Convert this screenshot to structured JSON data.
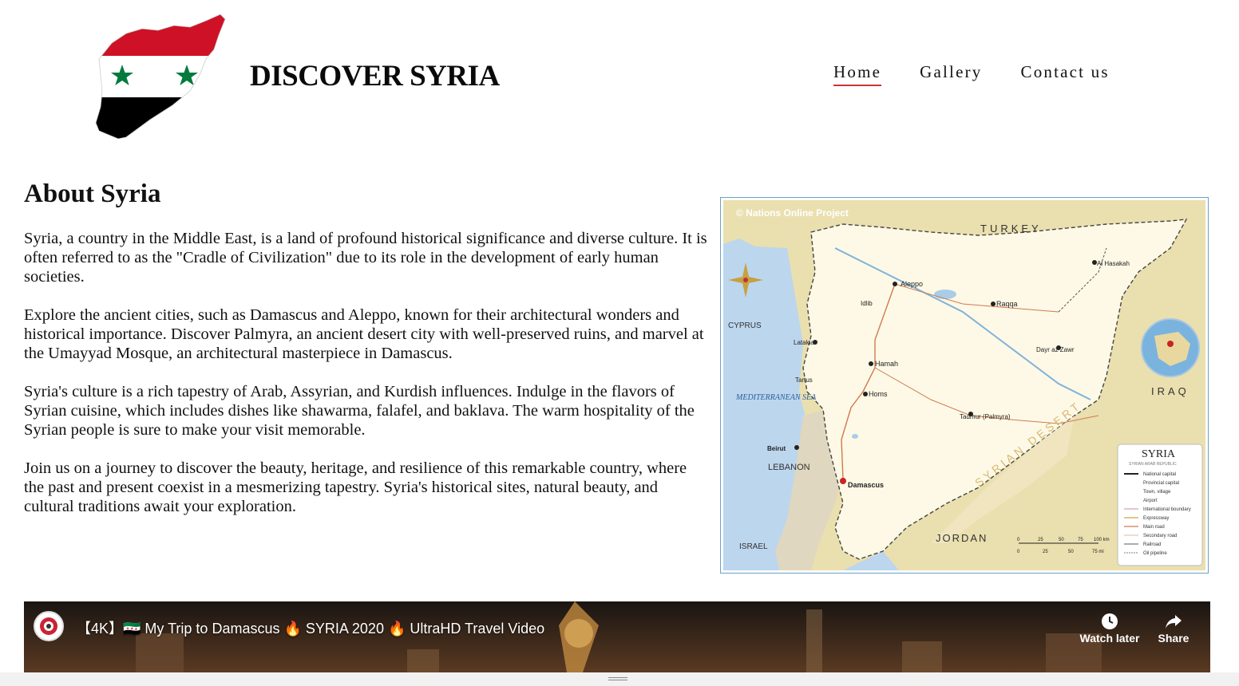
{
  "header": {
    "brand": "DISCOVER SYRIA",
    "nav": [
      {
        "label": "Home",
        "active": true
      },
      {
        "label": "Gallery",
        "active": false
      },
      {
        "label": "Contact us",
        "active": false
      }
    ],
    "flag_colors": {
      "red": "#ce1126",
      "white": "#ffffff",
      "black": "#000000",
      "star": "#007a3d"
    }
  },
  "main": {
    "title": "About Syria",
    "paragraphs": [
      "Syria, a country in the Middle East, is a land of profound historical significance and diverse culture. It is often referred to as the \"Cradle of Civilization\" due to its role in the development of early human societies.",
      "Explore the ancient cities, such as Damascus and Aleppo, known for their architectural wonders and historical importance. Discover Palmyra, an ancient desert city with well-preserved ruins, and marvel at the Umayyad Mosque, an architectural masterpiece in Damascus.",
      "Syria's culture is a rich tapestry of Arab, Assyrian, and Kurdish influences. Indulge in the flavors of Syrian cuisine, which includes dishes like shawarma, falafel, and baklava. The warm hospitality of the Syrian people is sure to make your visit memorable.",
      "Join us on a journey to discover the beauty, heritage, and resilience of this remarkable country, where the past and present coexist in a mesmerizing tapestry. Syria's historical sites, natural beauty, and cultural traditions await your exploration."
    ]
  },
  "map": {
    "credit": "© Nations Online Project",
    "countries": {
      "turkey": "TURKEY",
      "iraq": "IRAQ",
      "jordan": "JORDAN",
      "lebanon": "LEBANON",
      "israel": "ISRAEL",
      "cyprus": "CYPRUS",
      "sea": "MEDITERRANEAN SEA",
      "desert": "SYRIAN DESERT"
    },
    "cities": {
      "aleppo": "Aleppo",
      "damascus": "Damascus",
      "homs": "Homs",
      "hamah": "Hamah",
      "latakia": "Latakia",
      "raqqa": "Raqqa",
      "palmyra": "Tadmur (Palmyra)",
      "beirut": "Beirut",
      "tartus": "Tartus",
      "hasakah": "Al Hasakah",
      "deir": "Dayr az Zawr",
      "idlib": "Idlib"
    },
    "legend": {
      "title": "SYRIA",
      "subtitle": "SYRIAN ARAB REPUBLIC",
      "items": [
        "National capital",
        "Provincial capital",
        "Town, village",
        "Airport",
        "International boundary",
        "Expressway",
        "Main road",
        "Secondary road",
        "Railroad",
        "Oil pipeline"
      ],
      "scale_km": [
        "0",
        "25",
        "50",
        "75",
        "100 km"
      ],
      "scale_mi": [
        "0",
        "25",
        "50",
        "75 mi"
      ]
    }
  },
  "video": {
    "title": "【4K】🇸🇾 My Trip to Damascus 🔥 SYRIA 2020 🔥 UltraHD Travel Video",
    "watch_later": "Watch later",
    "share": "Share"
  }
}
